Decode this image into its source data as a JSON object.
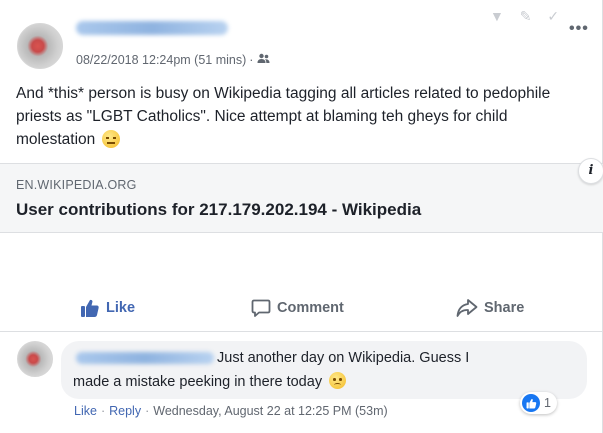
{
  "post": {
    "timestamp": "08/22/2018 12:24pm (51 mins)",
    "separator": "·",
    "audience_icon": "friends-icon",
    "more_label": "•••",
    "top_icons_label": "▼ ✎ ✓",
    "text": "And *this* person is busy on Wikipedia tagging all articles related to pedophile priests as \"LGBT Catholics\". Nice attempt at blaming teh gheys for child molestation",
    "text_emoji": "expressionless-face"
  },
  "link_preview": {
    "domain": "EN.WIKIPEDIA.ORG",
    "title": "User contributions for 217.179.202.194 - Wikipedia",
    "info_label": "i"
  },
  "actions": {
    "like": "Like",
    "comment": "Comment",
    "share": "Share",
    "like_color": "#4267b2"
  },
  "comment": {
    "line1": "Just another day on Wikipedia. Guess I",
    "line2": "made a mistake peeking in there today",
    "emoji": "slightly-frowning-face",
    "like_link": "Like",
    "reply_link": "Reply",
    "dot": "·",
    "time": "Wednesday, August 22 at 12:25 PM (53m)",
    "reaction_count": "1"
  }
}
